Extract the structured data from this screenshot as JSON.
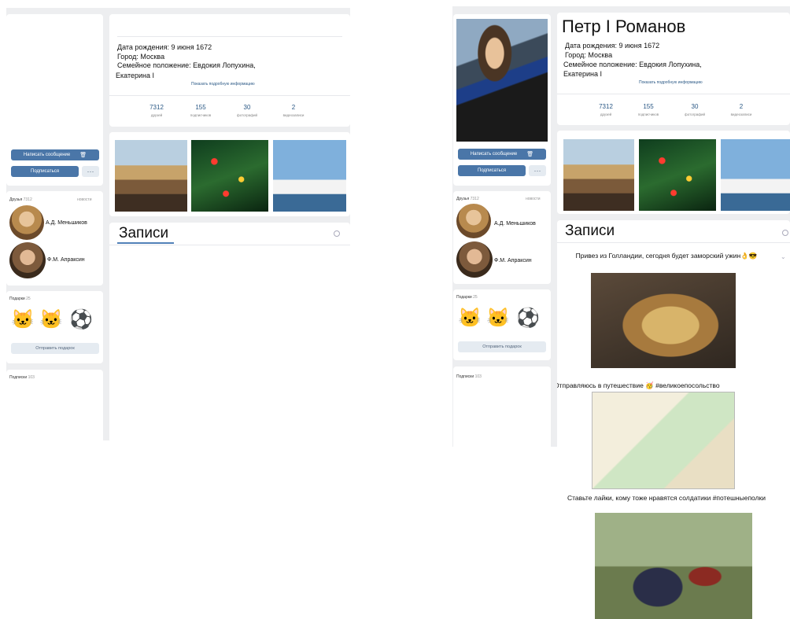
{
  "panels": [
    {
      "profile": {
        "name": "",
        "info_lines": [
          "Дата рождения: 9 июня 1672",
          "Город: Москва",
          "Семейное положение: Евдокия Лопухина,",
          "Екатерина I"
        ],
        "show_more": "Показать подробную информацию",
        "counts": [
          {
            "value": "7312",
            "label": "друзей"
          },
          {
            "value": "155",
            "label": "подписчиков"
          },
          {
            "value": "30",
            "label": "фотографий"
          },
          {
            "value": "2",
            "label": "видеозаписи"
          }
        ]
      },
      "actions": {
        "message": "Написать сообщение",
        "subscribe": "Подписаться",
        "more": "···"
      },
      "friends": {
        "title": "Друзья",
        "count": "7312",
        "updates": "новости",
        "items": [
          {
            "name": "А.Д. Меньшиков"
          },
          {
            "name": "Ф.М. Апраксин"
          }
        ]
      },
      "gifts": {
        "title": "Подарки",
        "count": "25",
        "send": "Отправить подарок"
      },
      "subscriptions": {
        "title": "Подписки",
        "count": "103"
      },
      "wall": {
        "title": "Записи",
        "posts": []
      }
    },
    {
      "profile": {
        "name": "Петр I Романов",
        "info_lines": [
          "Дата рождения: 9 июня 1672",
          "Город: Москва",
          "Семейное положение: Евдокия Лопухина,",
          "Екатерина I"
        ],
        "show_more": "Показать подробную информацию",
        "counts": [
          {
            "value": "7312",
            "label": "друзей"
          },
          {
            "value": "155",
            "label": "подписчиков"
          },
          {
            "value": "30",
            "label": "фотографий"
          },
          {
            "value": "2",
            "label": "видеозаписи"
          }
        ]
      },
      "actions": {
        "message": "Написать сообщение",
        "subscribe": "Подписаться",
        "more": "···"
      },
      "friends": {
        "title": "Друзья",
        "count": "7312",
        "updates": "новости",
        "items": [
          {
            "name": "А.Д. Меньшиков"
          },
          {
            "name": "Ф.М. Апраксин"
          }
        ]
      },
      "gifts": {
        "title": "Подарки",
        "count": "25",
        "send": "Отправить подарок"
      },
      "subscriptions": {
        "title": "Подписки",
        "count": "103"
      },
      "wall": {
        "title": "Записи",
        "posts": [
          {
            "text": "Привез из Голландии, сегодня будет заморский ужин👌😎"
          },
          {
            "text": "Отправляюсь в путешествие 🥳 #великоепосольство"
          },
          {
            "text": "Ставьте лайки, кому тоже нравятся солдатики #потешныеполки"
          }
        ]
      }
    }
  ],
  "colors": {
    "accent": "#4a76a8",
    "link": "#2a5885",
    "background": "#edeef0"
  },
  "icons": [
    "gift-icon",
    "search-icon",
    "chevron-down-icon",
    "avatar-portrait-icon"
  ]
}
